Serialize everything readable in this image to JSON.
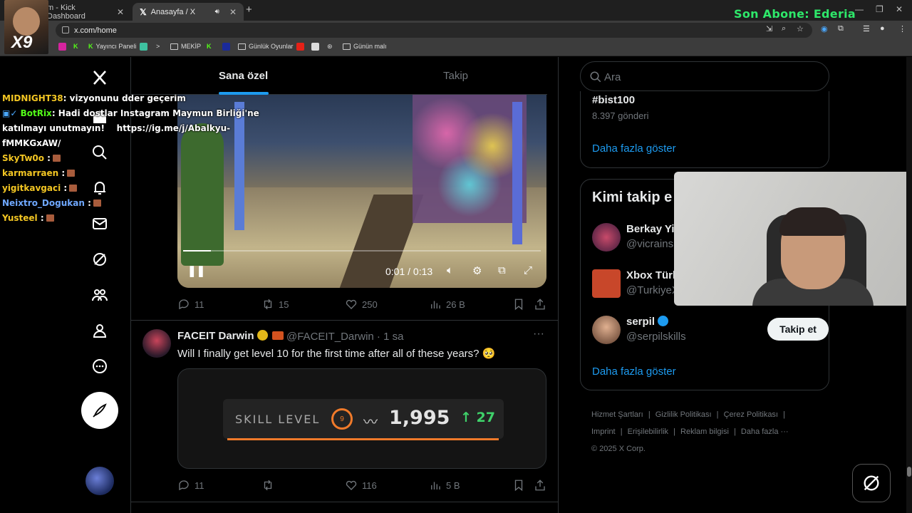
{
  "browser": {
    "tabs": [
      {
        "title": "m - Kick Dashboard"
      },
      {
        "title": "Anasayfa / X"
      }
    ],
    "url": "x.com/home",
    "bookmarks": [
      "Yayıncı Paneli",
      "MEKİP",
      "Günlük Oyunlar",
      "Günün malı"
    ]
  },
  "stream_overlay": {
    "sub_text": "Son Abone: Ederia",
    "multiplier": "X9",
    "chat": [
      {
        "user": "MIDNIGHT38",
        "msg": ": vizyonunu dder geçerim",
        "color": "#f3c623"
      },
      {
        "user": "BotRix",
        "msg": ": Hadi dostlar Instagram Maymun Birliği'ne",
        "color": "#53fc18"
      },
      {
        "user": "",
        "msg": "katılmayı unutmayın!    https://ig.me/j/Abalkyu-",
        "color": "#ffffff"
      },
      {
        "user": "",
        "msg": "fMMKGxAW/",
        "color": "#ffffff"
      },
      {
        "user": "SkyTw0o",
        "msg": " :",
        "color": "#f3c623"
      },
      {
        "user": "karmarraen",
        "msg": " :",
        "color": "#f3c623"
      },
      {
        "user": "yigitkavgaci",
        "msg": " :",
        "color": "#f3c623"
      },
      {
        "user": "Neixtro_Dogukan",
        "msg": " :",
        "color": "#6fa8ff"
      },
      {
        "user": "Yusteel",
        "msg": " :",
        "color": "#f3c623"
      }
    ]
  },
  "timeline": {
    "tab_for_you": "Sana özel",
    "tab_following": "Takip",
    "video_post": {
      "time_display": "0:01 / 0:13",
      "progress": 0.077,
      "replies": "11",
      "reposts": "15",
      "likes": "250",
      "views": "26 B"
    },
    "tweet": {
      "name": "FACEIT Darwin",
      "handle": "@FACEIT_Darwin · 1 sa",
      "text": "Will I finally get level 10 for the first time after all of these years? 🥺",
      "skill_label": "SKILL LEVEL",
      "level": "9",
      "elo": "1,995",
      "elo_delta": "↑ 27",
      "replies": "11",
      "reposts": "",
      "likes": "116",
      "views": "5 B"
    }
  },
  "sidebar": {
    "search_placeholder": "Ara",
    "trend_tag": "#bist100",
    "trend_count": "8.397 gönderi",
    "show_more": "Daha fazla göster",
    "who_to_follow_title": "Kimi takip e",
    "suggestions": [
      {
        "name": "Berkay Yi",
        "handle": "@vicrains",
        "verified": false
      },
      {
        "name": "Xbox Türk",
        "handle": "@TurkiyeX",
        "verified": false
      },
      {
        "name": "serpil",
        "handle": "@serpilskills",
        "verified": true,
        "button": "Takip et"
      }
    ],
    "show_more_2": "Daha fazla göster",
    "footer": [
      "Hizmet Şartları",
      "|",
      "Gizlilik Politikası",
      "|",
      "Çerez Politikası",
      "|",
      "Imprint",
      "|",
      "Erişilebilirlik",
      "|",
      "Reklam bilgisi",
      "|",
      "Daha fazla ···"
    ],
    "copyright": "© 2025 X Corp."
  },
  "colors": {
    "accent": "#1d9bf0",
    "background": "#000000",
    "muted": "#71767b"
  }
}
